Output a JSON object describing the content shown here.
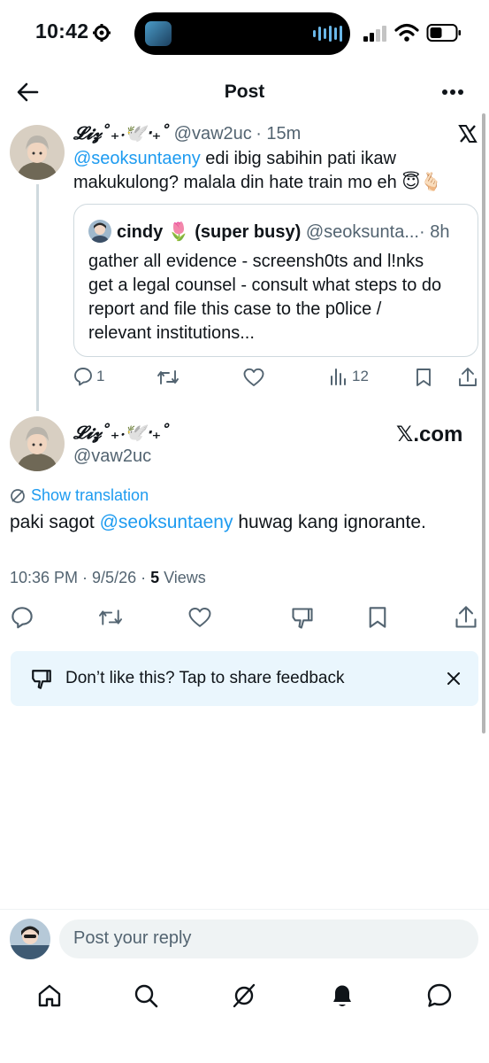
{
  "status_bar": {
    "time": "10:42"
  },
  "header": {
    "title": "Post"
  },
  "parent_tweet": {
    "display_name": "𝓛𝓲𝔃˚₊‧🕊️‧₊˚",
    "handle": "@vaw2uc",
    "time": "· 15m",
    "mention": "@seoksuntaeny",
    "text_line1_rest": " edi ibig sabihin pati ikaw",
    "text_line2": "makukulong? malala din hate train mo eh 😇🫰🏻",
    "actions": {
      "replies": "1",
      "views": "12"
    },
    "quote": {
      "display_name": "cindy 🌷 (super busy)",
      "handle": "@seoksunta...",
      "time": "· 8h",
      "lines": [
        "gather all evidence - screensh0ts and l!nks",
        "get a legal counsel - consult what steps to do",
        "report and file this case to the p0lice /",
        "relevant institutions..."
      ]
    }
  },
  "main_tweet": {
    "display_name": "𝓛𝓲𝔃˚₊‧🕊️‧₊˚",
    "handle": "@vaw2uc",
    "watermark": "𝕏.com",
    "translation_label": "Show translation",
    "text_before": "paki sagot ",
    "mention": "@seoksuntaeny",
    "text_after": " huwag kang ignorante.",
    "timestamp": "10:36 PM · 9/5/26 · ",
    "views_count": "5",
    "views_label": " Views"
  },
  "feedback": {
    "text": "Don’t like this? Tap to share feedback"
  },
  "reply": {
    "placeholder": "Post your reply"
  },
  "colors": {
    "accent": "#1d9bf0",
    "text": "#0f1419",
    "secondary": "#536471",
    "feedback_bg": "#eaf6fd"
  },
  "icons": [
    "back-arrow-icon",
    "more-icon",
    "x-logo-icon",
    "reply-icon",
    "repost-icon",
    "like-icon",
    "views-icon",
    "bookmark-icon",
    "share-icon",
    "dislike-icon",
    "translate-icon",
    "close-icon",
    "home-icon",
    "search-icon",
    "grok-icon",
    "notifications-icon",
    "messages-icon"
  ]
}
